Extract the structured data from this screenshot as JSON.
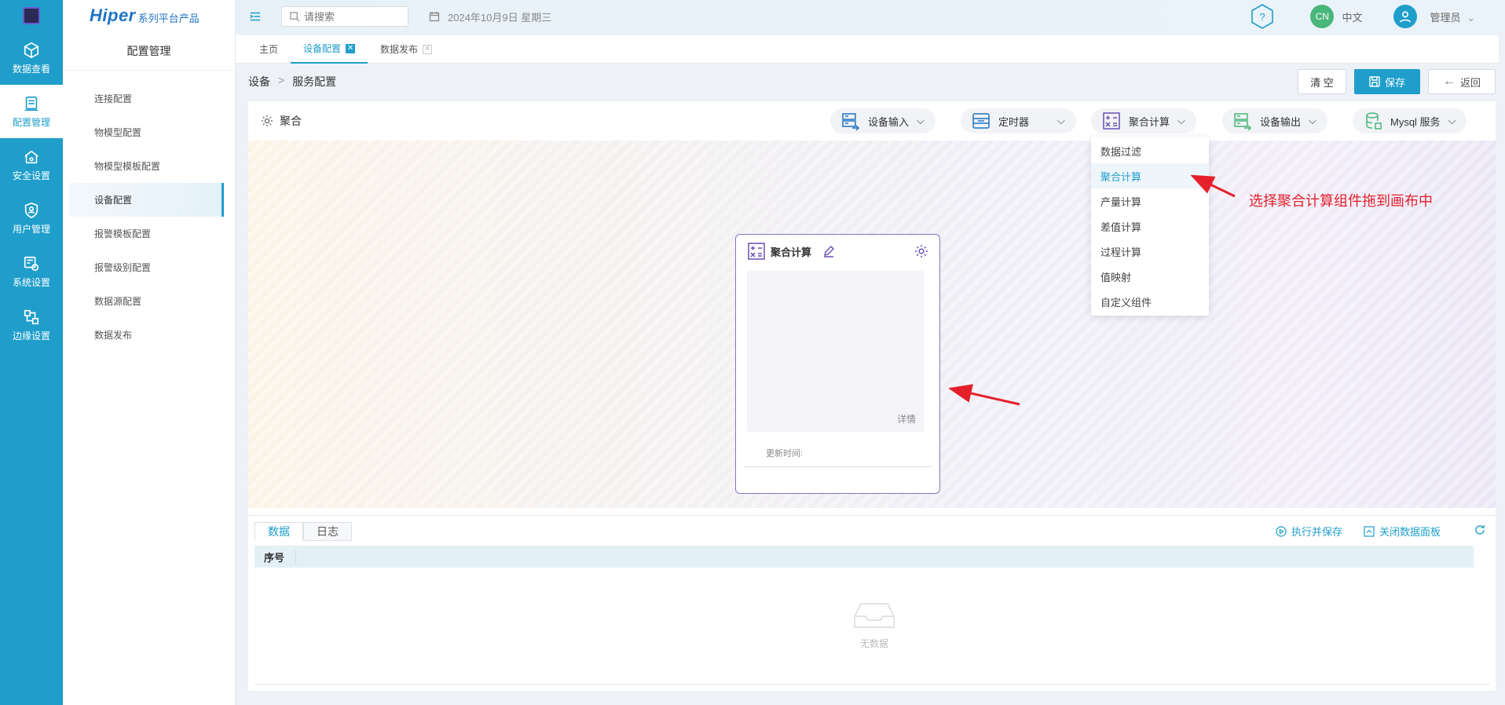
{
  "app": {
    "brand_main": "Hiper",
    "brand_sub": "系列平台产品"
  },
  "rail": {
    "items": [
      {
        "label": "数据查看",
        "icon": "cube-icon"
      },
      {
        "label": "配置管理",
        "icon": "config-doc-icon"
      },
      {
        "label": "安全设置",
        "icon": "security-house-icon"
      },
      {
        "label": "用户管理",
        "icon": "user-shield-icon"
      },
      {
        "label": "系统设置",
        "icon": "system-gear-icon"
      },
      {
        "label": "边缘设置",
        "icon": "edge-nodes-icon"
      }
    ]
  },
  "sidebar": {
    "title": "配置管理",
    "items": [
      {
        "label": "连接配置"
      },
      {
        "label": "物模型配置"
      },
      {
        "label": "物模型模板配置"
      },
      {
        "label": "设备配置"
      },
      {
        "label": "报警模板配置"
      },
      {
        "label": "报警级别配置"
      },
      {
        "label": "数据源配置"
      },
      {
        "label": "数据发布"
      }
    ],
    "active_index": 3
  },
  "topbar": {
    "search_placeholder": "请搜索",
    "date": "2024年10月9日 星期三",
    "lang_badge": "CN",
    "lang_label": "中文",
    "user_label": "管理员"
  },
  "tabs": [
    {
      "label": "主页"
    },
    {
      "label": "设备配置"
    },
    {
      "label": "数据发布"
    }
  ],
  "breadcrumb": {
    "root": "设备",
    "sep": ">",
    "current": "服务配置"
  },
  "actions": {
    "clear": "清 空",
    "save": "保存",
    "back": "返回"
  },
  "panel": {
    "title": "聚合",
    "toolbar": [
      {
        "label": "设备输入",
        "icon": "device-input-icon"
      },
      {
        "label": "定时器",
        "icon": "timer-icon"
      },
      {
        "label": "聚合计算",
        "icon": "calc-icon"
      },
      {
        "label": "设备输出",
        "icon": "device-output-icon"
      },
      {
        "label": "Mysql 服务",
        "icon": "database-icon"
      }
    ]
  },
  "dropdown": {
    "items": [
      {
        "label": "数据过滤"
      },
      {
        "label": "聚合计算"
      },
      {
        "label": "产量计算"
      },
      {
        "label": "差值计算"
      },
      {
        "label": "过程计算"
      },
      {
        "label": "值映射"
      },
      {
        "label": "自定义组件"
      }
    ],
    "highlighted_index": 1
  },
  "annotation": "选择聚合计算组件拖到画布中",
  "node": {
    "title": "聚合计算",
    "detail": "详情",
    "update_label": "更新时间:"
  },
  "bottom": {
    "tabs": [
      {
        "label": "数据"
      },
      {
        "label": "日志"
      }
    ],
    "run_save": "执行并保存",
    "close_panel": "关闭数据面板",
    "column_seq": "序号",
    "empty_text": "无数据"
  },
  "colors": {
    "primary": "#1f9ecb",
    "annotation": "#e5202b",
    "node_border": "#8a72c8"
  }
}
